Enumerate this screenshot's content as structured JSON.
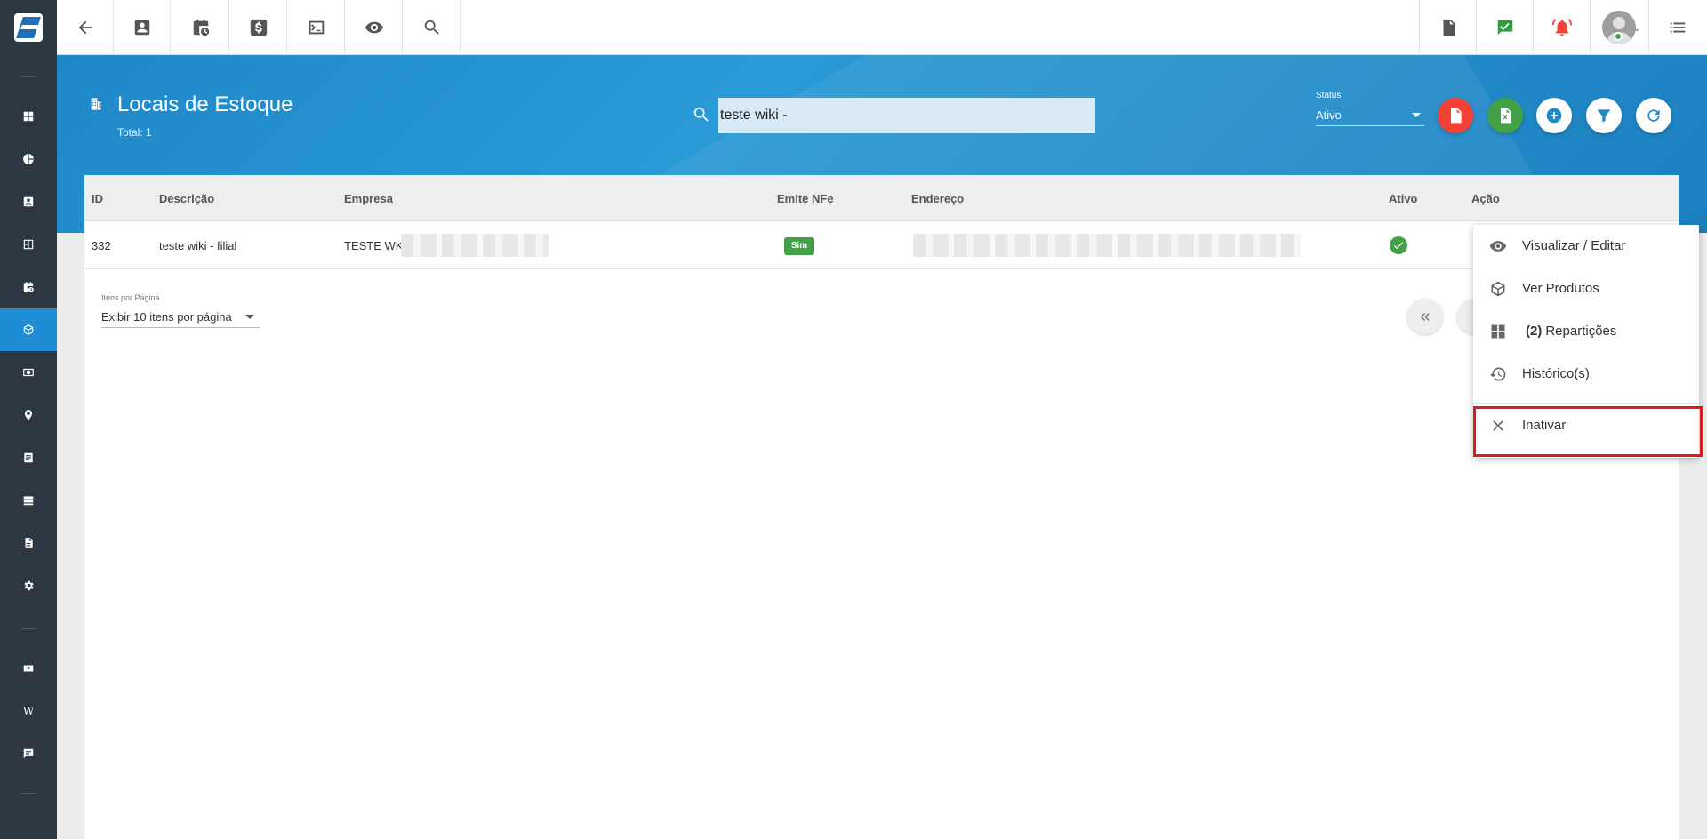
{
  "header": {
    "title": "Locais de Estoque",
    "total": "Total: 1",
    "search_value": "teste wiki -",
    "status_label": "Status",
    "status_value": "Ativo"
  },
  "table": {
    "columns": [
      "ID",
      "Descrição",
      "Empresa",
      "Emite NFe",
      "Endereço",
      "Ativo",
      "Ação"
    ],
    "rows": [
      {
        "id": "332",
        "descricao": "teste wiki - filial",
        "empresa": "TESTE WK",
        "emite_nfe": "Sim",
        "ativo": true
      }
    ]
  },
  "pagination": {
    "items_per_page_label": "Itens por Página",
    "items_per_page_value": "Exibir 10 itens por página",
    "first_page_glyph": "«"
  },
  "action_menu": {
    "items": [
      {
        "label": "Visualizar / Editar",
        "icon": "eye-icon"
      },
      {
        "label": "Ver Produtos",
        "icon": "cube-icon"
      },
      {
        "count": "(2)",
        "label": "Repartições",
        "icon": "grid-icon"
      },
      {
        "label": "Histórico(s)",
        "icon": "history-icon"
      },
      {
        "label": "Inativar",
        "icon": "close-icon",
        "highlighted": true
      }
    ]
  },
  "sidebar": {
    "active_item": "stock-locations",
    "wiki_glyph": "W"
  },
  "colors": {
    "banner": "#1f88c9",
    "sidebar": "#2d3741",
    "active": "#1f8dd6",
    "success": "#43a047",
    "danger": "#f44336",
    "highlight": "#e01b1b"
  }
}
